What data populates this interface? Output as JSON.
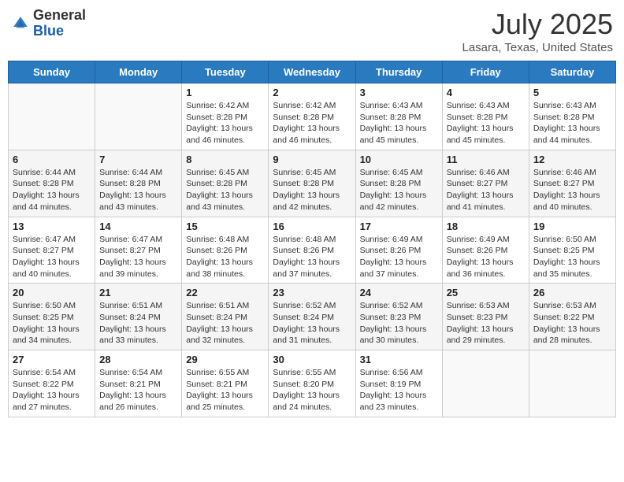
{
  "header": {
    "logo_general": "General",
    "logo_blue": "Blue",
    "month_title": "July 2025",
    "location": "Lasara, Texas, United States"
  },
  "weekdays": [
    "Sunday",
    "Monday",
    "Tuesday",
    "Wednesday",
    "Thursday",
    "Friday",
    "Saturday"
  ],
  "weeks": [
    [
      {
        "day": "",
        "info": ""
      },
      {
        "day": "",
        "info": ""
      },
      {
        "day": "1",
        "info": "Sunrise: 6:42 AM\nSunset: 8:28 PM\nDaylight: 13 hours and 46 minutes."
      },
      {
        "day": "2",
        "info": "Sunrise: 6:42 AM\nSunset: 8:28 PM\nDaylight: 13 hours and 46 minutes."
      },
      {
        "day": "3",
        "info": "Sunrise: 6:43 AM\nSunset: 8:28 PM\nDaylight: 13 hours and 45 minutes."
      },
      {
        "day": "4",
        "info": "Sunrise: 6:43 AM\nSunset: 8:28 PM\nDaylight: 13 hours and 45 minutes."
      },
      {
        "day": "5",
        "info": "Sunrise: 6:43 AM\nSunset: 8:28 PM\nDaylight: 13 hours and 44 minutes."
      }
    ],
    [
      {
        "day": "6",
        "info": "Sunrise: 6:44 AM\nSunset: 8:28 PM\nDaylight: 13 hours and 44 minutes."
      },
      {
        "day": "7",
        "info": "Sunrise: 6:44 AM\nSunset: 8:28 PM\nDaylight: 13 hours and 43 minutes."
      },
      {
        "day": "8",
        "info": "Sunrise: 6:45 AM\nSunset: 8:28 PM\nDaylight: 13 hours and 43 minutes."
      },
      {
        "day": "9",
        "info": "Sunrise: 6:45 AM\nSunset: 8:28 PM\nDaylight: 13 hours and 42 minutes."
      },
      {
        "day": "10",
        "info": "Sunrise: 6:45 AM\nSunset: 8:28 PM\nDaylight: 13 hours and 42 minutes."
      },
      {
        "day": "11",
        "info": "Sunrise: 6:46 AM\nSunset: 8:27 PM\nDaylight: 13 hours and 41 minutes."
      },
      {
        "day": "12",
        "info": "Sunrise: 6:46 AM\nSunset: 8:27 PM\nDaylight: 13 hours and 40 minutes."
      }
    ],
    [
      {
        "day": "13",
        "info": "Sunrise: 6:47 AM\nSunset: 8:27 PM\nDaylight: 13 hours and 40 minutes."
      },
      {
        "day": "14",
        "info": "Sunrise: 6:47 AM\nSunset: 8:27 PM\nDaylight: 13 hours and 39 minutes."
      },
      {
        "day": "15",
        "info": "Sunrise: 6:48 AM\nSunset: 8:26 PM\nDaylight: 13 hours and 38 minutes."
      },
      {
        "day": "16",
        "info": "Sunrise: 6:48 AM\nSunset: 8:26 PM\nDaylight: 13 hours and 37 minutes."
      },
      {
        "day": "17",
        "info": "Sunrise: 6:49 AM\nSunset: 8:26 PM\nDaylight: 13 hours and 37 minutes."
      },
      {
        "day": "18",
        "info": "Sunrise: 6:49 AM\nSunset: 8:26 PM\nDaylight: 13 hours and 36 minutes."
      },
      {
        "day": "19",
        "info": "Sunrise: 6:50 AM\nSunset: 8:25 PM\nDaylight: 13 hours and 35 minutes."
      }
    ],
    [
      {
        "day": "20",
        "info": "Sunrise: 6:50 AM\nSunset: 8:25 PM\nDaylight: 13 hours and 34 minutes."
      },
      {
        "day": "21",
        "info": "Sunrise: 6:51 AM\nSunset: 8:24 PM\nDaylight: 13 hours and 33 minutes."
      },
      {
        "day": "22",
        "info": "Sunrise: 6:51 AM\nSunset: 8:24 PM\nDaylight: 13 hours and 32 minutes."
      },
      {
        "day": "23",
        "info": "Sunrise: 6:52 AM\nSunset: 8:24 PM\nDaylight: 13 hours and 31 minutes."
      },
      {
        "day": "24",
        "info": "Sunrise: 6:52 AM\nSunset: 8:23 PM\nDaylight: 13 hours and 30 minutes."
      },
      {
        "day": "25",
        "info": "Sunrise: 6:53 AM\nSunset: 8:23 PM\nDaylight: 13 hours and 29 minutes."
      },
      {
        "day": "26",
        "info": "Sunrise: 6:53 AM\nSunset: 8:22 PM\nDaylight: 13 hours and 28 minutes."
      }
    ],
    [
      {
        "day": "27",
        "info": "Sunrise: 6:54 AM\nSunset: 8:22 PM\nDaylight: 13 hours and 27 minutes."
      },
      {
        "day": "28",
        "info": "Sunrise: 6:54 AM\nSunset: 8:21 PM\nDaylight: 13 hours and 26 minutes."
      },
      {
        "day": "29",
        "info": "Sunrise: 6:55 AM\nSunset: 8:21 PM\nDaylight: 13 hours and 25 minutes."
      },
      {
        "day": "30",
        "info": "Sunrise: 6:55 AM\nSunset: 8:20 PM\nDaylight: 13 hours and 24 minutes."
      },
      {
        "day": "31",
        "info": "Sunrise: 6:56 AM\nSunset: 8:19 PM\nDaylight: 13 hours and 23 minutes."
      },
      {
        "day": "",
        "info": ""
      },
      {
        "day": "",
        "info": ""
      }
    ]
  ]
}
